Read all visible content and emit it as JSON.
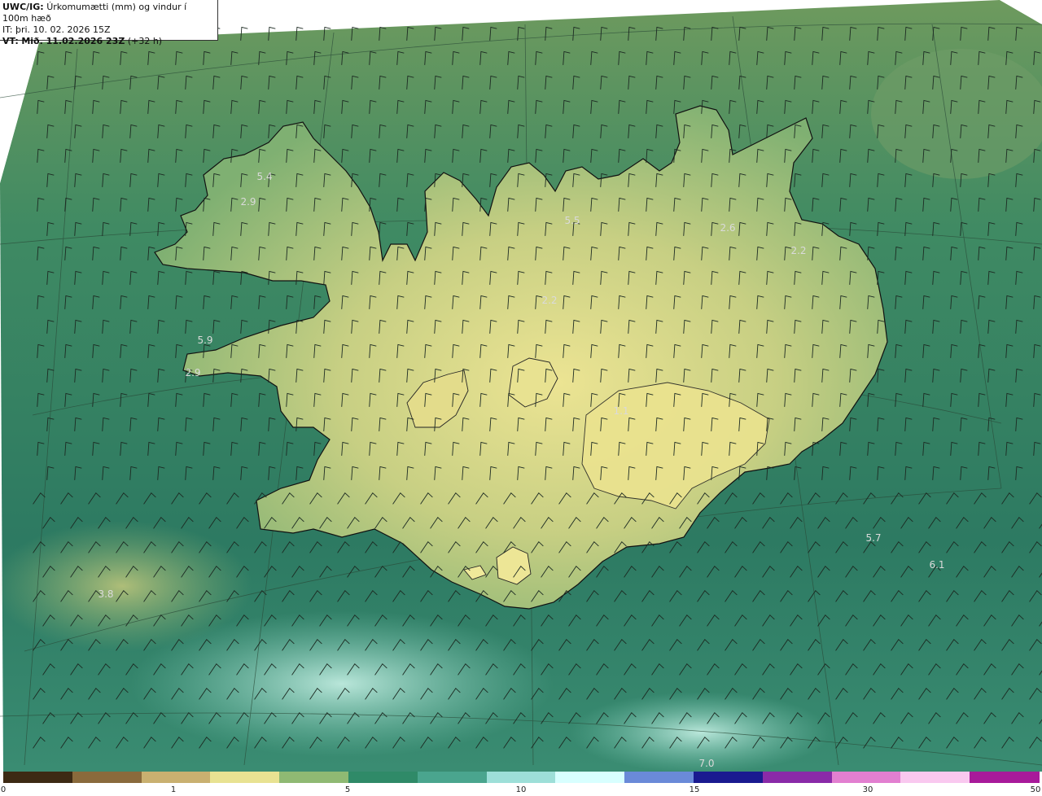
{
  "header": {
    "product_code": "UWC/IG:",
    "product_title": "Úrkomumætti (mm) og vindur í 100m hæð",
    "init_time": "IT: þri. 10. 02. 2026 15Z",
    "valid_label": "VT:",
    "valid_time": "Mið. 11.02.2026 23Z",
    "valid_offset": "(+32 h)"
  },
  "value_labels": [
    "5.4",
    "2.9",
    "5.5",
    "2.6",
    "2.2",
    "2.2",
    "5.9",
    "2.9",
    "1.1",
    "5.7",
    "6.1",
    "3.8",
    "7.0"
  ],
  "colorbar": {
    "ticks": [
      "0",
      "1",
      "5",
      "10",
      "15",
      "30",
      "50"
    ],
    "colors": [
      "#3d2a14",
      "#8a6a3c",
      "#c9b070",
      "#e8e292",
      "#8fb973",
      "#2f8a68",
      "#4aa58e",
      "#9ddfd8",
      "#d8ffff",
      "#6a8ad8",
      "#1a1a90",
      "#8a2aa8",
      "#e27fd0",
      "#f9c8ef",
      "#a81a9a"
    ]
  },
  "colors": {
    "ocean_north": "#3f8a63",
    "ocean_south": "#2d7a62",
    "land_low": "#a6c07a",
    "land_high": "#e3dd8e",
    "coast": "#111111"
  }
}
